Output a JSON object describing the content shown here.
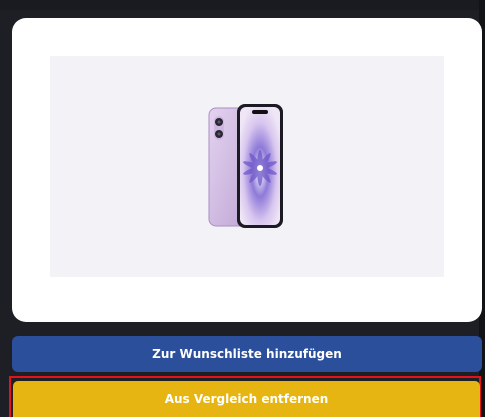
{
  "product": {
    "image_icon": "iphone-image"
  },
  "actions": {
    "wishlist_label": "Zur Wunschliste hinzufügen",
    "remove_compare_label": "Aus Vergleich entfernen"
  },
  "colors": {
    "background": "#1e1f25",
    "wishlist_button": "#2b4f9a",
    "remove_button": "#e7b512",
    "highlight": "#e0141e"
  }
}
